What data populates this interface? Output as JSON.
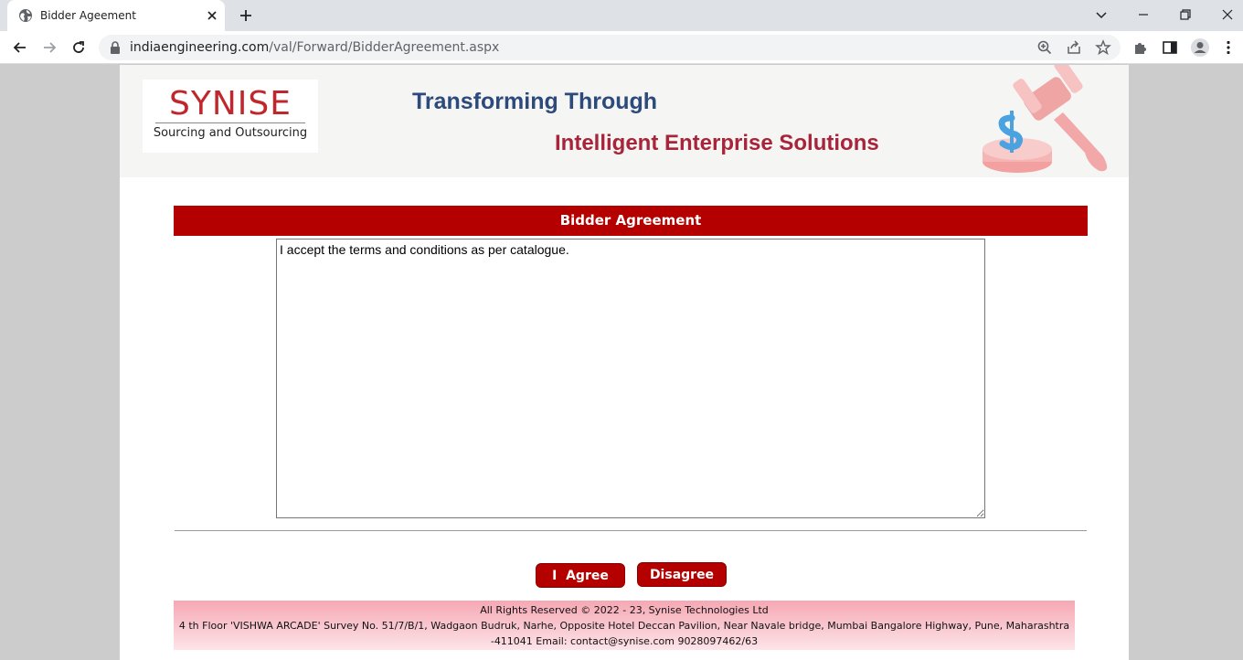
{
  "browser": {
    "tab_title": "Bidder Ageement",
    "url_domain": "indiaengineering.com",
    "url_path": "/val/Forward/BidderAgreement.aspx"
  },
  "banner": {
    "logo_name": "SYNISE",
    "logo_tagline": "Sourcing and Outsourcing",
    "tagline_line1": "Transforming Through",
    "tagline_line2": "Intelligent Enterprise Solutions"
  },
  "agreement": {
    "header": "Bidder Agreement",
    "text": "I accept the terms and conditions as per catalogue."
  },
  "buttons": {
    "agree_label": "I  Agree",
    "disagree_label": "Disagree"
  },
  "footer": {
    "line1": "All Rights Reserved © 2022 - 23, Synise Technologies Ltd",
    "line2": "4 th Floor 'VISHWA ARCADE' Survey No. 51/7/B/1, Wadgaon Budruk, Narhe, Opposite Hotel Deccan Pavilion, Near Navale bridge, Mumbai Bangalore Highway, Pune, Maharashtra",
    "line3": "-411041 Email: contact@synise.com 9028097462/63"
  },
  "colors": {
    "header_red": "#b50000",
    "tagline_blue": "#2d4a7c",
    "tagline_red": "#a8243a",
    "logo_red": "#c0272d"
  }
}
